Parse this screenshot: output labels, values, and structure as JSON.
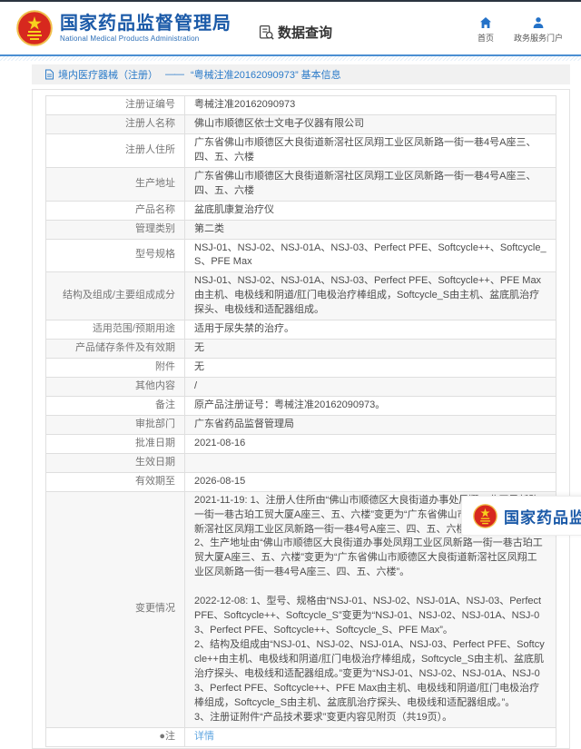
{
  "header": {
    "agency_cn": "国家药品监督管理局",
    "agency_en": "National Medical Products Administration",
    "data_query": "数据查询",
    "home": "首页",
    "portal": "政务服务门户"
  },
  "breadcrumb": {
    "section": "境内医疗器械（注册）",
    "separator": "——",
    "title": "“粤械注准20162090973” 基本信息"
  },
  "table": {
    "rows": [
      {
        "label": "注册证编号",
        "value": "粤械注准20162090973"
      },
      {
        "label": "注册人名称",
        "value": "佛山市顺德区依士文电子仪器有限公司"
      },
      {
        "label": "注册人住所",
        "value": "广东省佛山市顺德区大良街道新滘社区凤翔工业区凤新路一街一巷4号A座三、四、五、六楼"
      },
      {
        "label": "生产地址",
        "value": "广东省佛山市顺德区大良街道新滘社区凤翔工业区凤新路一街一巷4号A座三、四、五、六楼"
      },
      {
        "label": "产品名称",
        "value": "盆底肌康复治疗仪"
      },
      {
        "label": "管理类别",
        "value": "第二类"
      },
      {
        "label": "型号规格",
        "value": "NSJ-01、NSJ-02、NSJ-01A、NSJ-03、Perfect PFE、Softcycle++、Softcycle_S、PFE Max"
      },
      {
        "label": "结构及组成/主要组成成分",
        "value": "NSJ-01、NSJ-02、NSJ-01A、NSJ-03、Perfect PFE、Softcycle++、PFE Max由主机、电极线和阴道/肛门电极治疗棒组成，Softcycle_S由主机、盆底肌治疗探头、电极线和适配器组成。"
      },
      {
        "label": "适用范围/预期用途",
        "value": "适用于尿失禁的治疗。"
      },
      {
        "label": "产品储存条件及有效期",
        "value": "无"
      },
      {
        "label": "附件",
        "value": "无"
      },
      {
        "label": "其他内容",
        "value": "/"
      },
      {
        "label": "备注",
        "value": "原产品注册证号：粤械注准20162090973。"
      },
      {
        "label": "审批部门",
        "value": "广东省药品监督管理局"
      },
      {
        "label": "批准日期",
        "value": "2021-08-16"
      },
      {
        "label": "生效日期",
        "value": ""
      },
      {
        "label": "有效期至",
        "value": "2026-08-15"
      },
      {
        "label": "变更情况",
        "value": "2021-11-19: 1、注册人住所由“佛山市顺德区大良街道办事处凤翔工业区凤新路一街一巷古珀工贸大厦A座三、五、六楼”变更为“广东省佛山市顺德区大良街道新滘社区凤翔工业区凤新路一街一巷4号A座三、四、五、六楼”。\n2、生产地址由“佛山市顺德区大良街道办事处凤翔工业区凤新路一街一巷古珀工贸大厦A座三、五、六楼”变更为“广东省佛山市顺德区大良街道新滘社区凤翔工业区凤新路一街一巷4号A座三、四、五、六楼”。\n\n2022-12-08: 1、型号、规格由“NSJ-01、NSJ-02、NSJ-01A、NSJ-03、Perfect PFE、Softcycle++、Softcycle_S”变更为“NSJ-01、NSJ-02、NSJ-01A、NSJ-03、Perfect PFE、Softcycle++、Softcycle_S、PFE Max”。\n2、结构及组成由“NSJ-01、NSJ-02、NSJ-01A、NSJ-03、Perfect PFE、Softcycle++由主机、电极线和阴道/肛门电极治疗棒组成，Softcycle_S由主机、盆底肌治疗探头、电极线和适配器组成。”变更为“NSJ-01、NSJ-02、NSJ-01A、NSJ-03、Perfect PFE、Softcycle++、PFE Max由主机、电极线和阴道/肛门电极治疗棒组成，Softcycle_S由主机、盆底肌治疗探头、电极线和适配器组成。”。\n3、注册证附件“产品技术要求”变更内容见附页（共19页）。"
      },
      {
        "label": "●注",
        "value": "详情"
      }
    ]
  },
  "footer_badge": {
    "text": "国家药品监"
  },
  "colors": {
    "accent_blue": "#1b5aa8",
    "breadcrumb_blue": "#2b7bc9",
    "link_light_blue": "#5ea5e0",
    "emblem_red": "#d7281e",
    "emblem_gold": "#f2c14e",
    "divider_blue": "#4b8fd2"
  }
}
